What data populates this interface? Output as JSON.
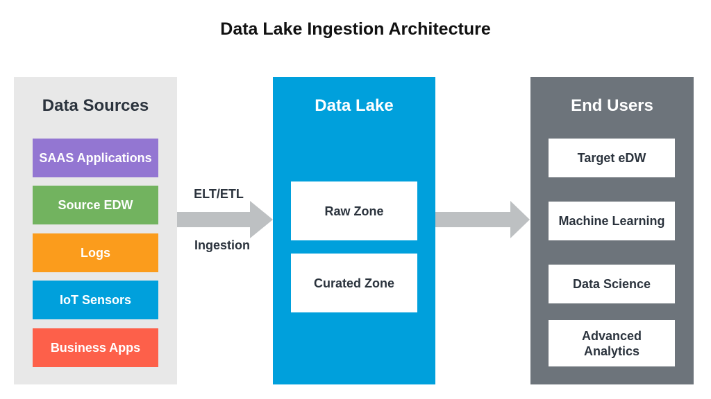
{
  "title": "Data Lake Ingestion Architecture",
  "colors": {
    "sources_panel": "#e8e8e8",
    "lake_panel": "#00a0dc",
    "users_panel": "#6d747b",
    "arrow": "#bdc0c2",
    "dark_text": "#2b333d"
  },
  "sources": {
    "title": "Data Sources",
    "items": [
      {
        "label": "SAAS Applications",
        "color": "#9376d2"
      },
      {
        "label": "Source EDW",
        "color": "#72b35f"
      },
      {
        "label": "Logs",
        "color": "#fb9c1c"
      },
      {
        "label": "IoT Sensors",
        "color": "#00a0dc"
      },
      {
        "label": "Business Apps",
        "color": "#fd604a"
      }
    ]
  },
  "ingest_arrow": {
    "top_label": "ELT/ETL",
    "bottom_label": "Ingestion"
  },
  "lake": {
    "title": "Data Lake",
    "zones": [
      {
        "label": "Raw Zone"
      },
      {
        "label": "Curated Zone"
      }
    ]
  },
  "users": {
    "title": "End Users",
    "items": [
      {
        "label": "Target eDW"
      },
      {
        "label": "Machine Learning"
      },
      {
        "label": "Data Science"
      },
      {
        "label": "Advanced Analytics"
      }
    ]
  }
}
